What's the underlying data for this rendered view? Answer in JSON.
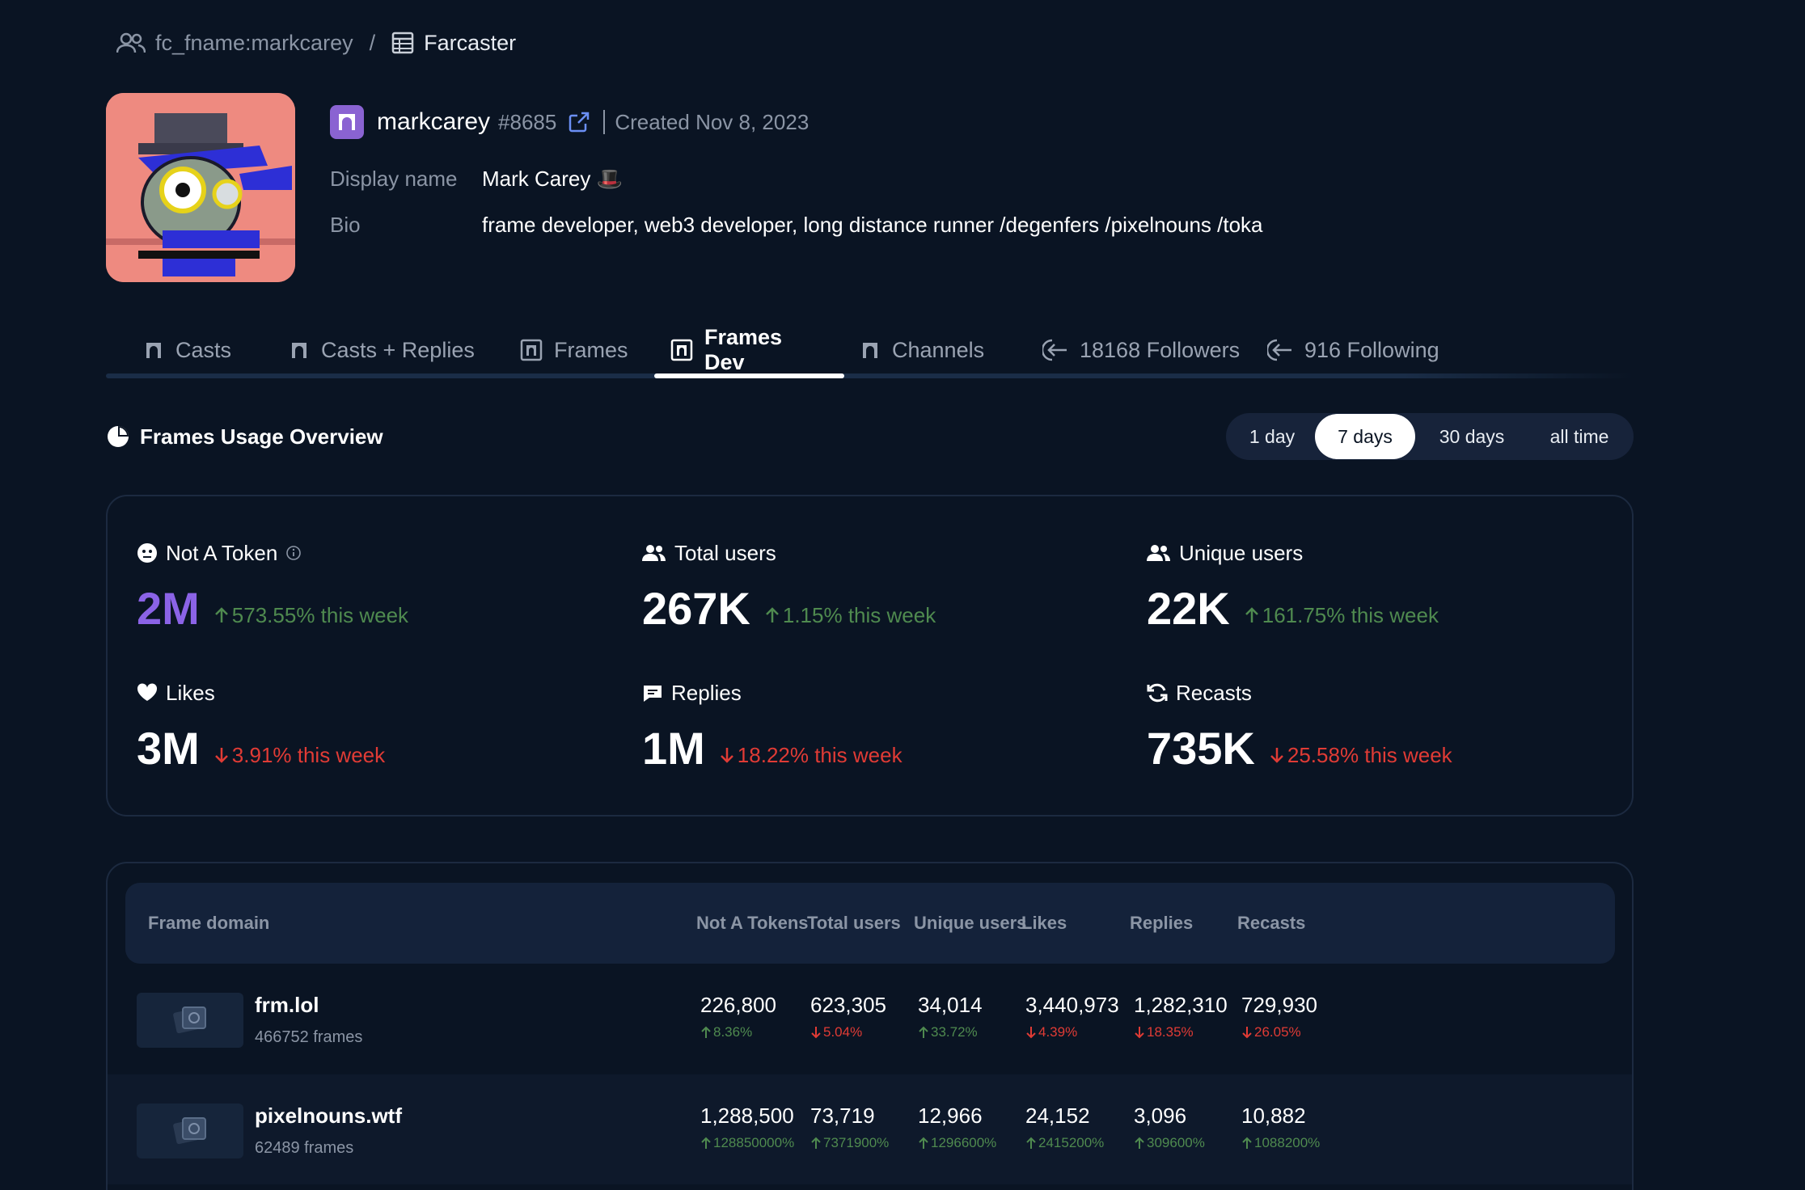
{
  "breadcrumb": {
    "user": "fc_fname:markcarey",
    "separator": "/",
    "source": "Farcaster"
  },
  "profile": {
    "username": "markcarey",
    "fid": "#8685",
    "created": "Created Nov 8, 2023",
    "display_name_label": "Display name",
    "display_name": "Mark Carey 🎩",
    "bio_label": "Bio",
    "bio": "frame developer, web3 developer, long distance runner /degenfers /pixelnouns /toka"
  },
  "tabs": [
    {
      "label": "Casts",
      "icon": "arch-icon"
    },
    {
      "label": "Casts + Replies",
      "icon": "arch-icon"
    },
    {
      "label": "Frames",
      "icon": "frame-icon"
    },
    {
      "label": "Frames Dev",
      "icon": "frame-icon",
      "active": true
    },
    {
      "label": "Channels",
      "icon": "arch-icon"
    },
    {
      "label": "18168 Followers",
      "icon": "arrow-in-icon"
    },
    {
      "label": "916 Following",
      "icon": "arrow-in-icon"
    }
  ],
  "overview": {
    "title": "Frames Usage Overview",
    "ranges": [
      "1 day",
      "7 days",
      "30 days",
      "all time"
    ],
    "selected_range": "7 days"
  },
  "stats": [
    {
      "label": "Not A Token",
      "icon": "token-icon",
      "value": "2M",
      "change": "573.55% this week",
      "direction": "up"
    },
    {
      "label": "Total users",
      "icon": "users-icon",
      "value": "267K",
      "change": "1.15% this week",
      "direction": "up"
    },
    {
      "label": "Unique users",
      "icon": "users-icon",
      "value": "22K",
      "change": "161.75% this week",
      "direction": "up"
    },
    {
      "label": "Likes",
      "icon": "heart-icon",
      "value": "3M",
      "change": "3.91% this week",
      "direction": "down"
    },
    {
      "label": "Replies",
      "icon": "chat-icon",
      "value": "1M",
      "change": "18.22% this week",
      "direction": "down"
    },
    {
      "label": "Recasts",
      "icon": "refresh-icon",
      "value": "735K",
      "change": "25.58% this week",
      "direction": "down"
    }
  ],
  "table": {
    "columns": [
      "Frame domain",
      "Not A Tokens",
      "Total users",
      "Unique users",
      "Likes",
      "Replies",
      "Recasts"
    ],
    "rows": [
      {
        "domain": "frm.lol",
        "frames": "466752 frames",
        "cells": [
          {
            "value": "226,800",
            "pct": "8.36%",
            "dir": "up"
          },
          {
            "value": "623,305",
            "pct": "5.04%",
            "dir": "down"
          },
          {
            "value": "34,014",
            "pct": "33.72%",
            "dir": "up"
          },
          {
            "value": "3,440,973",
            "pct": "4.39%",
            "dir": "down"
          },
          {
            "value": "1,282,310",
            "pct": "18.35%",
            "dir": "down"
          },
          {
            "value": "729,930",
            "pct": "26.05%",
            "dir": "down"
          }
        ]
      },
      {
        "domain": "pixelnouns.wtf",
        "frames": "62489 frames",
        "cells": [
          {
            "value": "1,288,500",
            "pct": "128850000%",
            "dir": "up"
          },
          {
            "value": "73,719",
            "pct": "7371900%",
            "dir": "up"
          },
          {
            "value": "12,966",
            "pct": "1296600%",
            "dir": "up"
          },
          {
            "value": "24,152",
            "pct": "2415200%",
            "dir": "up"
          },
          {
            "value": "3,096",
            "pct": "309600%",
            "dir": "up"
          },
          {
            "value": "10,882",
            "pct": "1088200%",
            "dir": "up"
          }
        ]
      }
    ]
  },
  "colors": {
    "background": "#0a1423",
    "accent_purple": "#8b63e6",
    "up": "#4f8a4f",
    "down": "#e03b35",
    "farcaster": "#8a63d2"
  }
}
